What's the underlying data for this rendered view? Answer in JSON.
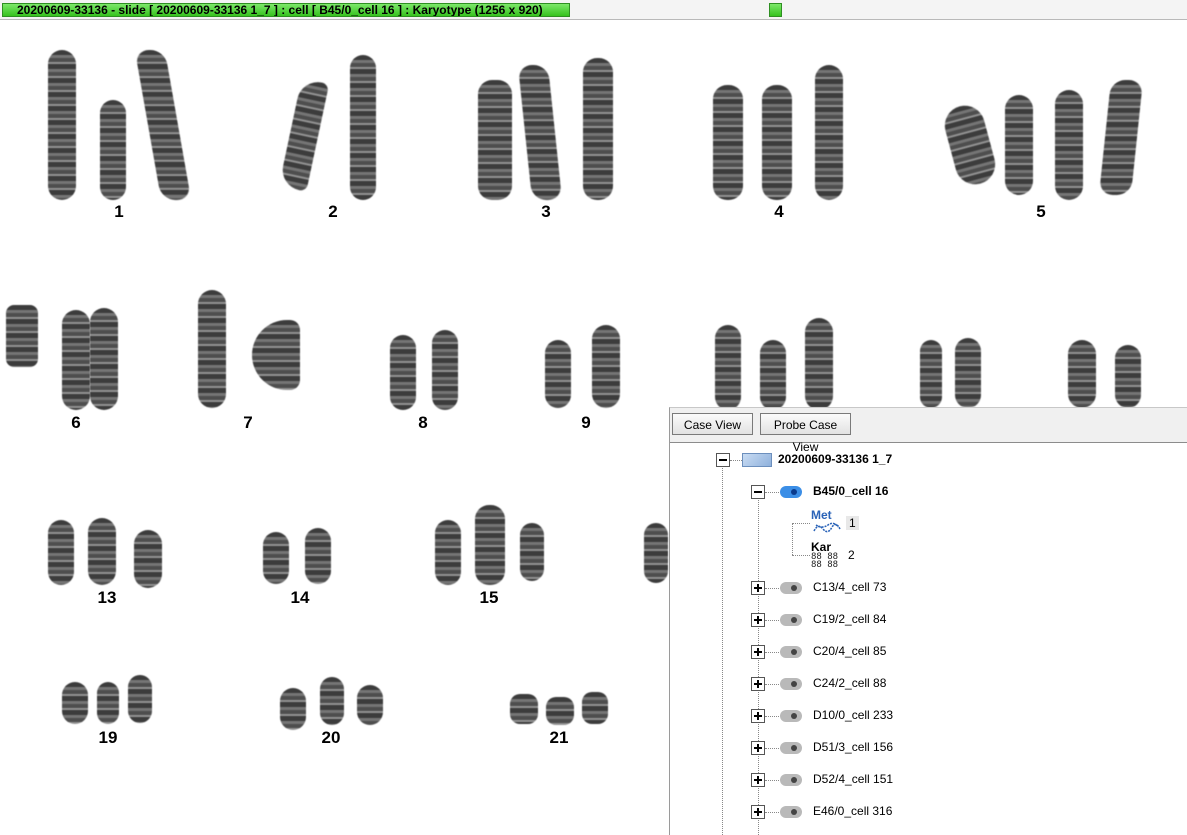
{
  "window": {
    "title": "20200609-33136 - slide [ 20200609-33136 1_7 ] : cell [ B45/0_cell 16 ] : Karyotype  (1256 x 920)"
  },
  "karyotype": {
    "labels": [
      "1",
      "2",
      "3",
      "4",
      "5",
      "6",
      "7",
      "8",
      "9",
      "13",
      "14",
      "15",
      "19",
      "20",
      "21"
    ]
  },
  "panel": {
    "buttons": [
      "Case View",
      "Probe Case View"
    ],
    "slide": "20200609-33136 1_7",
    "selected_cell": "B45/0_cell 16",
    "children": [
      {
        "label": "Met",
        "index": "1"
      },
      {
        "label": "Kar",
        "index": "2"
      }
    ],
    "cells": [
      "C13/4_cell 73",
      "C19/2_cell 84",
      "C20/4_cell 85",
      "C24/2_cell 88",
      "D10/0_cell 233",
      "D51/3_cell 156",
      "D52/4_cell 151",
      "E46/0_cell 316"
    ]
  }
}
